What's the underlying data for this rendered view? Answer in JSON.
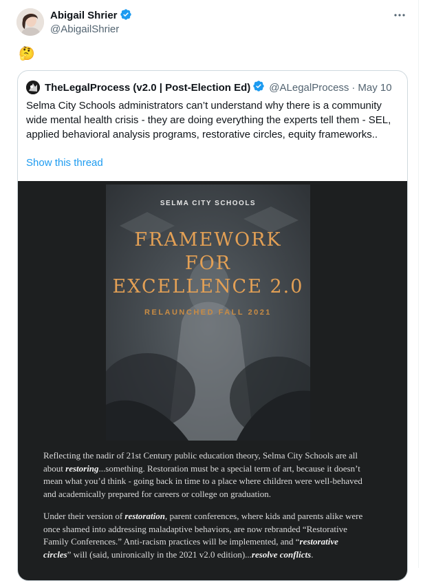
{
  "tweet": {
    "author_name": "Abigail Shrier",
    "author_handle": "@AbigailShrier",
    "body": "🤔",
    "more_icon": "ellipsis-icon"
  },
  "quote": {
    "author_name": "TheLegalProcess (v2.0 | Post-Election Ed)",
    "author_handle": "@ALegalProcess",
    "separator": "·",
    "date": "May 10",
    "text": "Selma City Schools administrators can’t understand why there is a community wide mental health crisis - they are doing everything the experts tell them - SEL, applied behavioral analysis programs, restorative circles, equity frameworks..",
    "show_thread": "Show this thread"
  },
  "document": {
    "cover_school": "SELMA CITY SCHOOLS",
    "cover_title": "FRAMEWORK\nFOR\nEXCELLENCE 2.0",
    "cover_subtitle": "RELAUNCHED FALL 2021",
    "p1_a": "Reflecting the nadir of 21st Century public education theory, Selma City Schools are all about ",
    "p1_em": "restoring",
    "p1_b": "...something. Restoration must be a special term of art, because it doesn’t mean what you’d think - going back in time to a place where children were well-behaved and academically prepared for careers or college on graduation.",
    "p2_a": "Under their version of ",
    "p2_em1": "restoration",
    "p2_b": ", parent conferences, where kids and parents alike were once shamed into addressing maladaptive behaviors, are now rebranded “Restorative Family Conferences.” Anti-racism practices will be implemented, and “",
    "p2_em2": "restorative circles",
    "p2_c": "” will (said, unironically in the 2021 v2.0 edition)...",
    "p2_em3": "resolve conflicts",
    "p2_d": "."
  },
  "colors": {
    "verified": "#1d9bf0",
    "link": "#1d9bf0",
    "secondary_text": "#536471",
    "cover_title": "#e3a055",
    "media_background": "#1d1f20"
  }
}
